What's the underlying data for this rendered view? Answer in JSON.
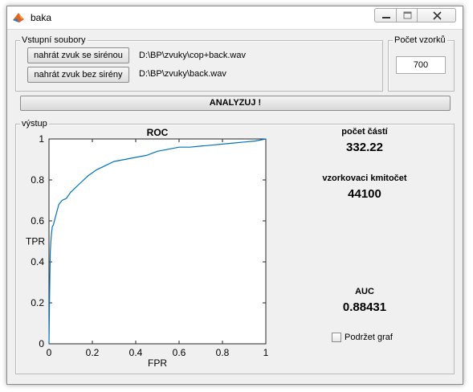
{
  "window": {
    "title": "baka",
    "icon": "matlab-icon",
    "controls": [
      "minimize-icon",
      "maximize-icon",
      "close-icon"
    ]
  },
  "input_panel": {
    "title": "Vstupní soubory",
    "buttons": [
      {
        "label": "nahrát zvuk se sirénou",
        "path": "D:\\BP\\zvuky\\cop+back.wav"
      },
      {
        "label": "nahrát zvuk bez sirény",
        "path": "D:\\BP\\zvuky\\back.wav"
      }
    ]
  },
  "samples_panel": {
    "title": "Počet vzorků",
    "value": "700"
  },
  "analyze_button": {
    "label": "ANALYZUJ !"
  },
  "output_panel": {
    "title": "výstup",
    "stats": [
      {
        "label": "počet částí",
        "value": "332.22"
      },
      {
        "label": "vzorkovaci kmitočet",
        "value": "44100"
      },
      {
        "label": "AUC",
        "value": "0.88431"
      }
    ],
    "hold_checkbox": {
      "label": "Podržet graf",
      "checked": false
    }
  },
  "chart_data": {
    "type": "line",
    "title": "ROC",
    "xlabel": "FPR",
    "ylabel": "TPR",
    "xlim": [
      0,
      1
    ],
    "ylim": [
      0,
      1
    ],
    "xticks": [
      "0",
      "0.2",
      "0.4",
      "0.6",
      "0.8",
      "1"
    ],
    "yticks": [
      "0",
      "0.2",
      "0.4",
      "0.6",
      "0.8",
      "1"
    ],
    "grid": false,
    "line_color": "#0072bd",
    "series": [
      {
        "x": [
          0,
          0.003,
          0.006,
          0.01,
          0.015,
          0.02,
          0.03,
          0.045,
          0.06,
          0.08,
          0.1,
          0.12,
          0.15,
          0.18,
          0.22,
          0.26,
          0.3,
          0.35,
          0.4,
          0.45,
          0.5,
          0.55,
          0.6,
          0.65,
          0.7,
          0.75,
          0.8,
          0.85,
          0.9,
          0.95,
          1
        ],
        "y": [
          0,
          0.25,
          0.45,
          0.52,
          0.57,
          0.58,
          0.62,
          0.68,
          0.7,
          0.71,
          0.74,
          0.76,
          0.79,
          0.82,
          0.85,
          0.87,
          0.89,
          0.9,
          0.91,
          0.92,
          0.94,
          0.95,
          0.96,
          0.96,
          0.965,
          0.97,
          0.975,
          0.98,
          0.985,
          0.99,
          1.0
        ]
      }
    ]
  }
}
